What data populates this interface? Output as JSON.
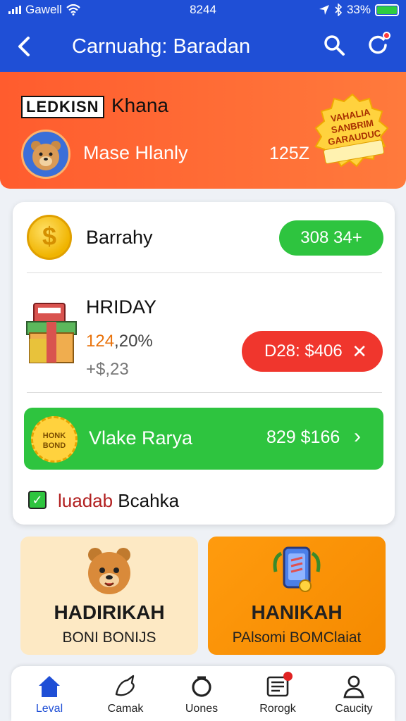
{
  "status": {
    "carrier": "Gawell",
    "time": "8244",
    "battery": "33%"
  },
  "header": {
    "title": "Carnuahg: Baradan",
    "back_icon": "chevron-left-icon",
    "search_icon": "search-icon",
    "refresh_icon": "refresh-icon"
  },
  "banner": {
    "badge": "LEDKISN",
    "name": "Khana",
    "user": "Mase Hlanly",
    "count": "125Z",
    "seal_text": "VAHALIA SANBRIM GARAUDUC",
    "colors": {
      "start": "#ff5c2e",
      "end": "#ff7a3c"
    }
  },
  "card": {
    "balance_label": "Barrahy",
    "balance_value": "308 34+",
    "promo_title": "HRIDAY",
    "promo_pct_prefix": "124",
    "promo_pct_rest": ",20%",
    "promo_sub": "+$,23",
    "red_button": "D28: $406",
    "green_bar": {
      "seal": "HONK BOND",
      "label": "Vlake Rarya",
      "amount": "829 $166"
    },
    "checkbox_label_red": "luadab",
    "checkbox_label_rest": " Bcahka",
    "checked": true,
    "accent_green": "#2ec43f",
    "accent_red": "#f0362d"
  },
  "tiles": [
    {
      "title": "HADIRIKAH",
      "subtitle": "BONI BONIJS"
    },
    {
      "title": "HANIKAH",
      "subtitle": "PAlsomi BOMClaiat"
    }
  ],
  "nav": [
    {
      "label": "Leval",
      "icon": "home-icon",
      "active": true
    },
    {
      "label": "Camak",
      "icon": "bird-icon",
      "active": false
    },
    {
      "label": "Uones",
      "icon": "ring-icon",
      "active": false
    },
    {
      "label": "Rorogk",
      "icon": "inbox-icon",
      "active": false,
      "badge": true
    },
    {
      "label": "Caucity",
      "icon": "user-icon",
      "active": false
    }
  ]
}
